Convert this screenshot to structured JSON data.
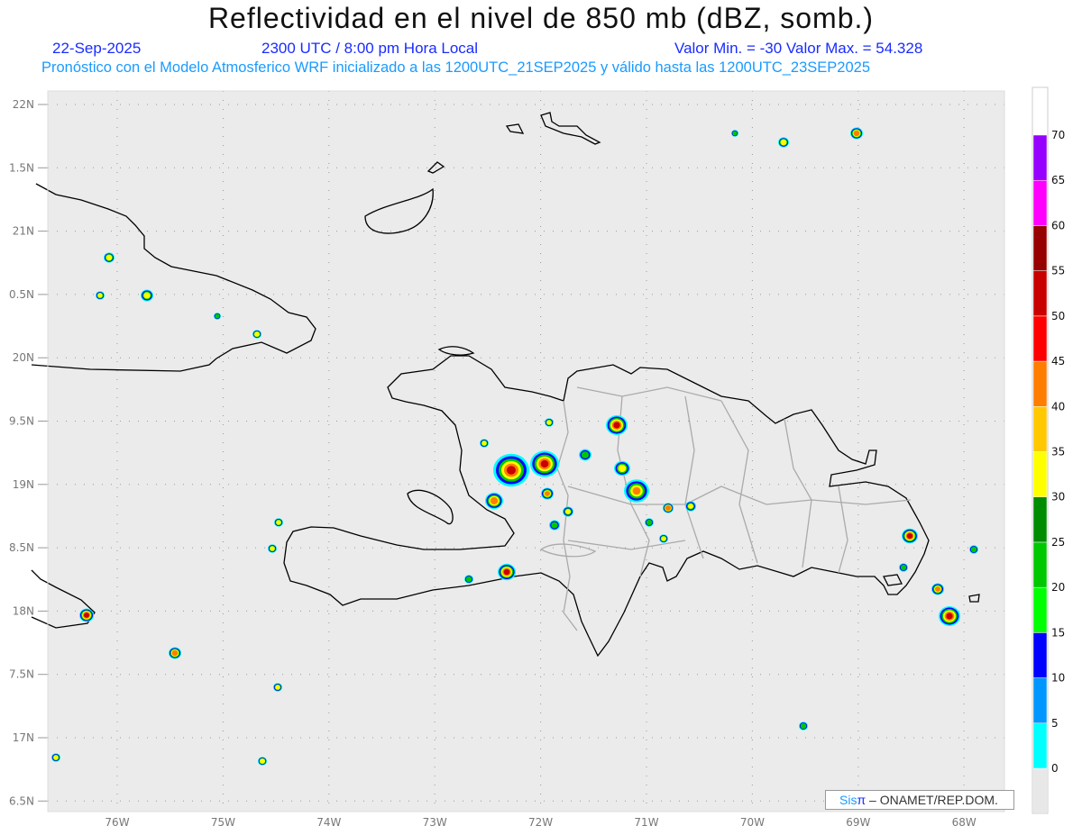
{
  "header": {
    "title": "Reflectividad en el nivel de 850 mb (dBZ, somb.)",
    "date": "22-Sep-2025",
    "time": "2300 UTC / 8:00 pm Hora Local",
    "minmax": "Valor Min. = -30  Valor Max. = 54.328",
    "model_info": "Pronóstico con el Modelo Atmosferico WRF inicializado a las 1200UTC_21SEP2025 y válido hasta las  1200UTC_23SEP2025"
  },
  "axes": {
    "lat_labels": [
      "22N",
      "1.5N",
      "21N",
      "0.5N",
      "20N",
      "9.5N",
      "19N",
      "8.5N",
      "18N",
      "7.5N",
      "17N",
      "6.5N"
    ],
    "lon_labels": [
      "76W",
      "75W",
      "74W",
      "73W",
      "72W",
      "71W",
      "70W",
      "69W",
      "68W"
    ]
  },
  "colorbar": {
    "labels": [
      "0",
      "5",
      "10",
      "15",
      "20",
      "25",
      "30",
      "35",
      "40",
      "45",
      "50",
      "55",
      "60",
      "65",
      "70"
    ],
    "colors": [
      "#00ffff",
      "#0096ff",
      "#0000ff",
      "#00ff00",
      "#00c800",
      "#008c00",
      "#ffff00",
      "#ffc800",
      "#ff7d00",
      "#ff0000",
      "#c80000",
      "#960000",
      "#ff00ff",
      "#9600ff"
    ]
  },
  "credit": {
    "sis": "Sis",
    "pi": "π",
    "text": " –  ONAMET/REP.DOM."
  }
}
